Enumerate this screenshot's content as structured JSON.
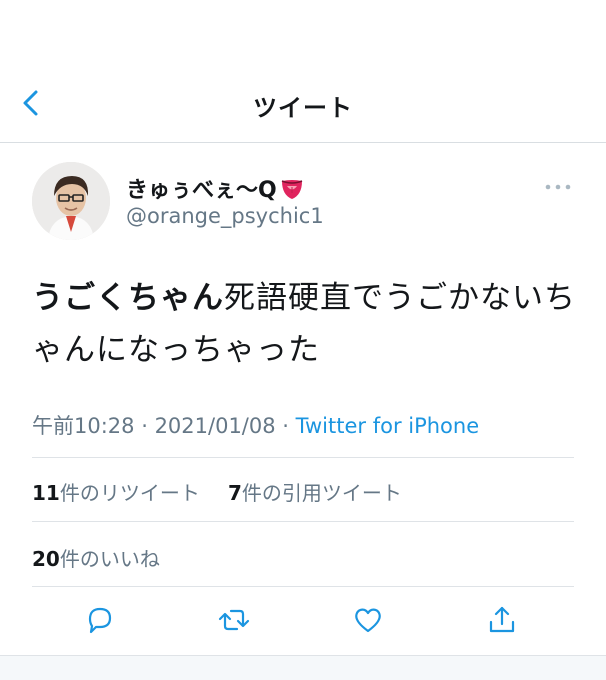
{
  "header": {
    "title": "ツイート"
  },
  "author": {
    "display_name": "きゅぅべぇ〜Q",
    "emoji": "tongue-emoji",
    "username": "@orange_psychic1"
  },
  "tweet": {
    "text_bold": "うごくちゃん",
    "text_rest": "死語硬直でうごかないちゃんになっちゃった"
  },
  "meta": {
    "time": "午前10:28",
    "sep1": " · ",
    "date": "2021/01/08",
    "sep2": " · ",
    "source": "Twitter for iPhone"
  },
  "stats": {
    "retweets_count": "11",
    "retweets_label": "件のリツイート",
    "quotes_count": "7",
    "quotes_label": "件の引用ツイート",
    "likes_count": "20",
    "likes_label": "件のいいね"
  },
  "colors": {
    "accent": "#1b95e0",
    "secondary_text": "#657786",
    "primary_text": "#14171a",
    "divider": "#dfe3e7"
  },
  "icons": [
    "back-chevron-icon",
    "more-dots-icon",
    "reply-icon",
    "retweet-icon",
    "like-icon",
    "share-icon"
  ]
}
